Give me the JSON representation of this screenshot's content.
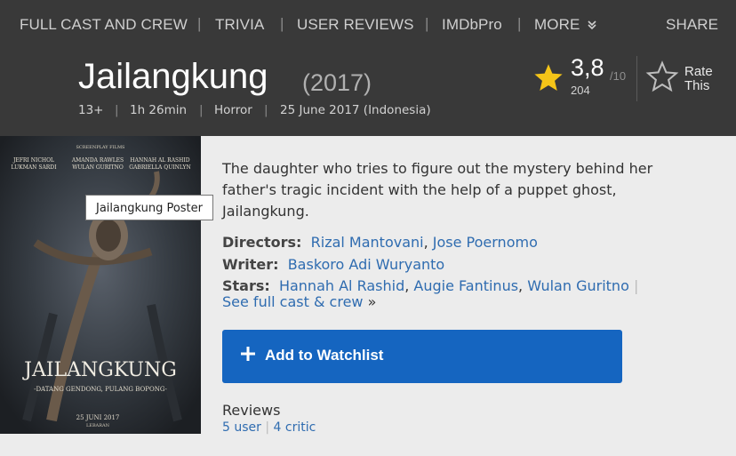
{
  "subnav": {
    "items": [
      "FULL CAST AND CREW",
      "TRIVIA",
      "USER REVIEWS",
      "IMDbPro",
      "MORE"
    ],
    "more_icon": "double-chevron-down-icon",
    "share": "SHARE"
  },
  "title": {
    "name": "Jailangkung",
    "year": "(2017)",
    "certificate": "13+",
    "runtime": "1h 26min",
    "genre": "Horror",
    "release": "25 June 2017 (Indonesia)"
  },
  "rating": {
    "value": "3,8",
    "max": "/10",
    "count": "204",
    "star_icon": "star-icon",
    "rate_label_1": "Rate",
    "rate_label_2": "This",
    "rate_icon": "star-outline-icon"
  },
  "poster": {
    "tooltip": "Jailangkung Poster",
    "top_line": "SCREENPLAY FILMS",
    "cast_row_1": [
      "JEFRI NICHOL",
      "AMANDA RAWLES",
      "HANNAH AL RASHID"
    ],
    "cast_row_2": [
      "LUKMAN SARDI",
      "WULAN GURITNO",
      "GABRIELLA QUINLYN"
    ],
    "film_title": "JAILANGKUNG",
    "tagline": "-DATANG GENDONG, PULANG BOPONG-",
    "date": "25 JUNI 2017",
    "date_sub": "LEBARAN"
  },
  "plot": "The daughter who tries to figure out the mystery behind her father's tragic incident with the help of a puppet ghost, Jailangkung.",
  "credits": {
    "directors_label": "Directors:",
    "directors": [
      "Rizal Mantovani",
      "Jose Poernomo"
    ],
    "writer_label": "Writer:",
    "writer": "Baskoro Adi Wuryanto",
    "stars_label": "Stars:",
    "stars": [
      "Hannah Al Rashid",
      "Augie Fantinus",
      "Wulan Guritno"
    ],
    "see_full": "See full cast & crew",
    "see_full_arrow": "»"
  },
  "watchlist": {
    "label": "Add to Watchlist",
    "icon": "plus-icon"
  },
  "reviews": {
    "title": "Reviews",
    "user": "5 user",
    "critic": "4 critic"
  },
  "colors": {
    "header_bg": "#393939",
    "page_bg": "#ececec",
    "link": "#2f6cb0",
    "watchlist_bg": "#1565c0",
    "star": "#f5c518"
  }
}
